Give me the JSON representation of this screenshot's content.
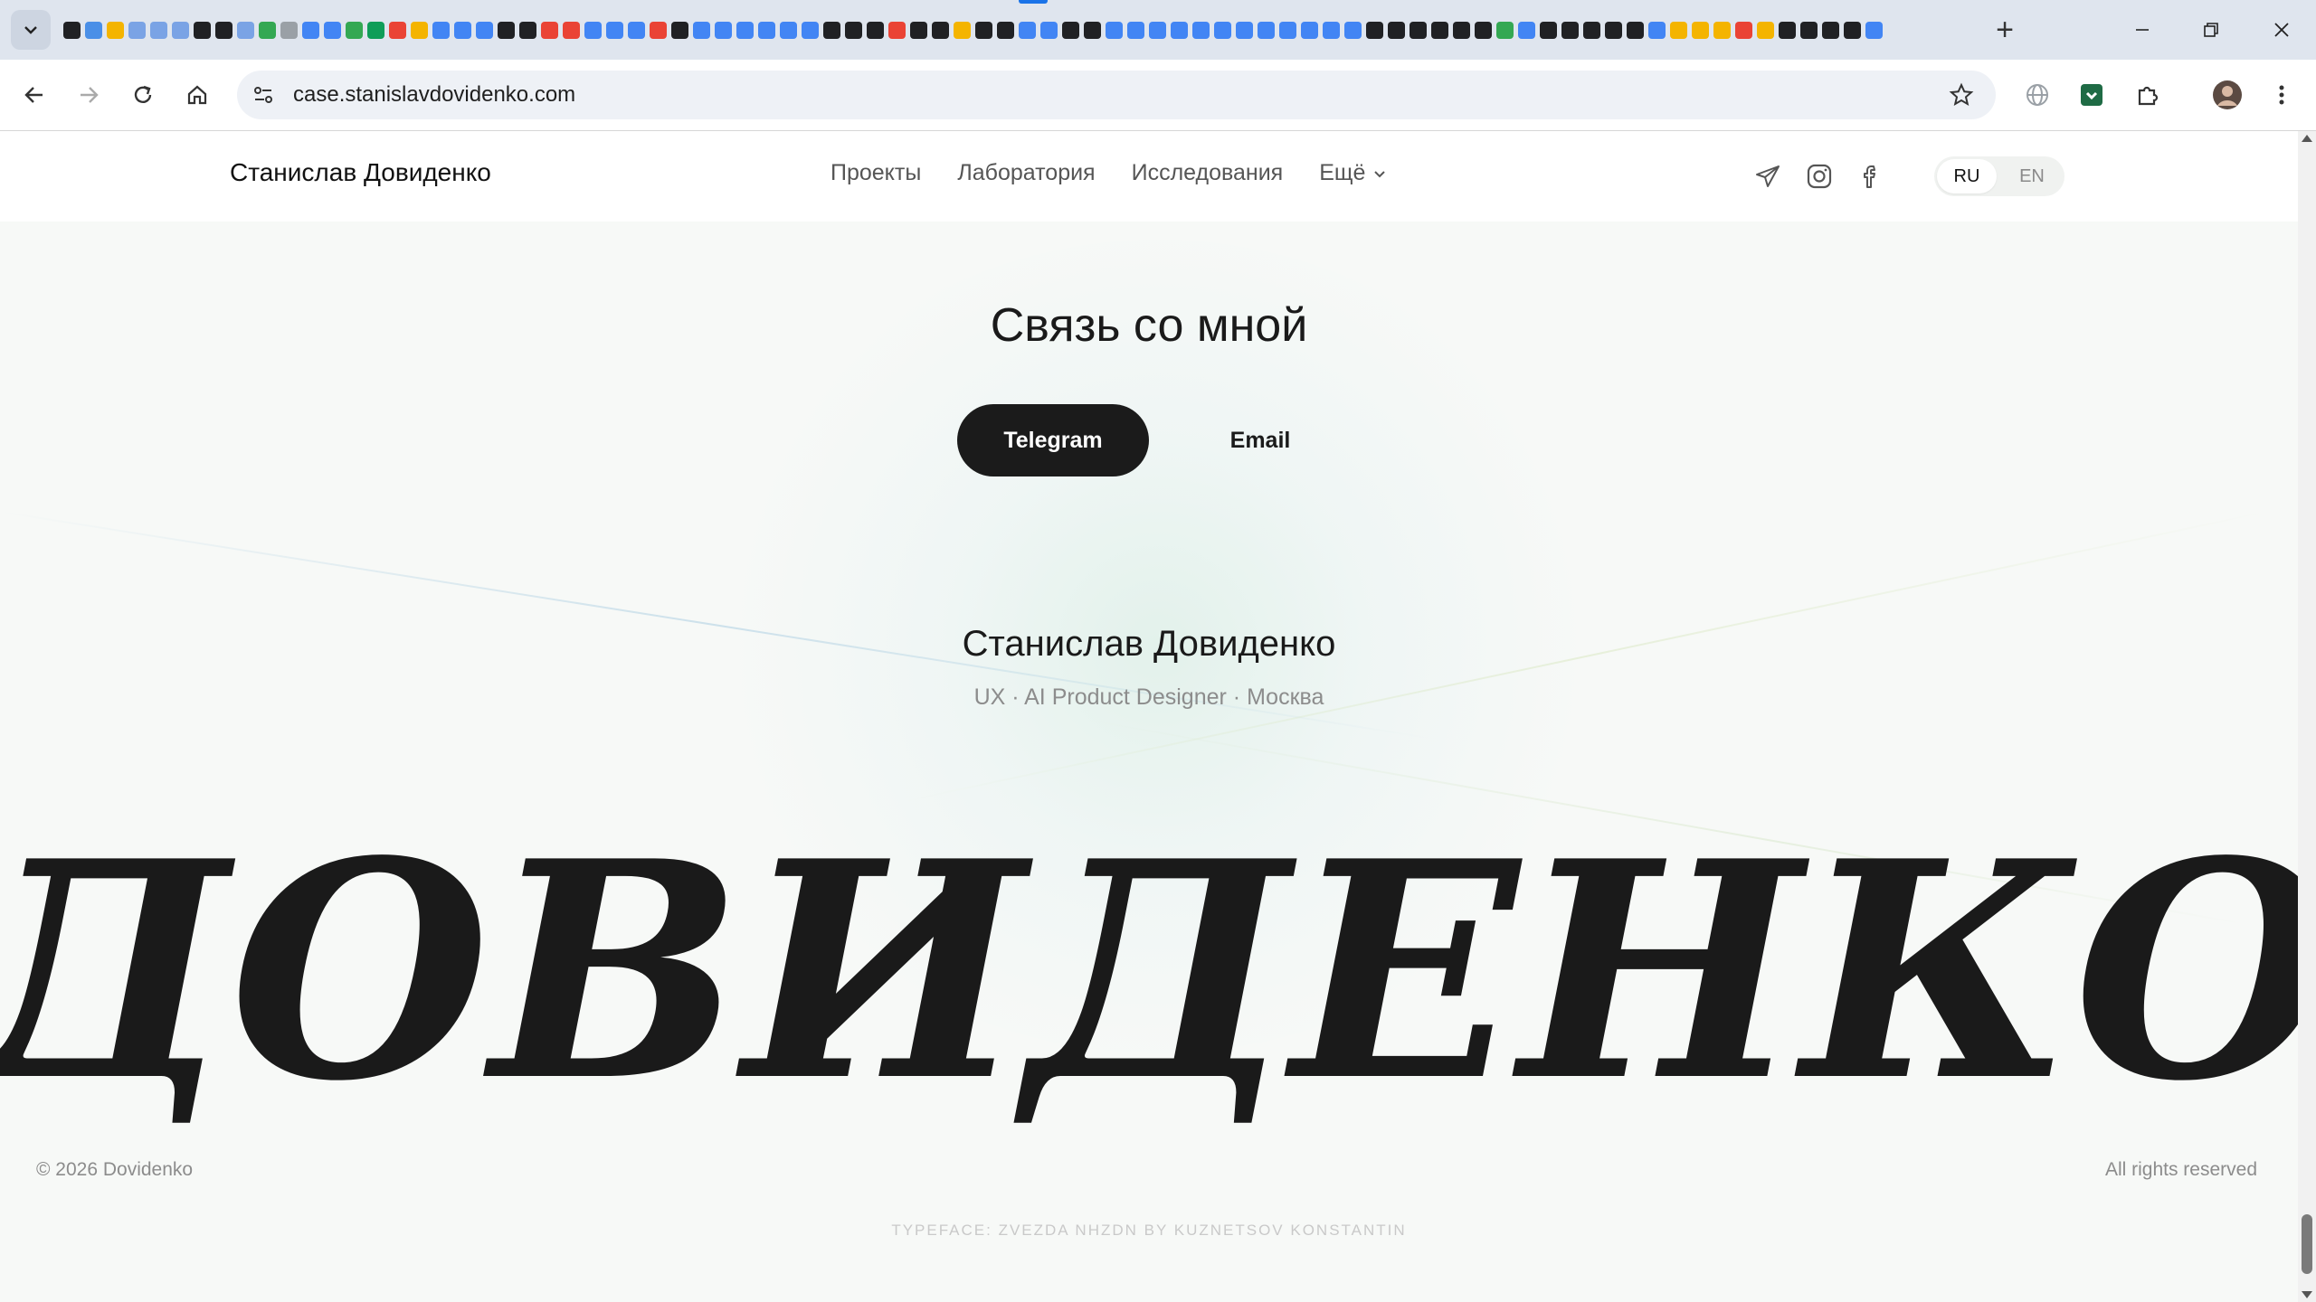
{
  "browser": {
    "url": "case.stanislavdovidenko.com",
    "new_tab_label": "+",
    "favicon_colors": [
      "#202124",
      "#4a8fe7",
      "#f4b400",
      "#7aa3e5",
      "#7aa3e5",
      "#7aa3e5",
      "#202124",
      "#202124",
      "#7aa3e5",
      "#34a853",
      "#9aa0a6",
      "#4285f4",
      "#4285f4",
      "#34a853",
      "#0f9d58",
      "#ea4335",
      "#f4b400",
      "#4285f4",
      "#4285f4",
      "#4285f4",
      "#202124",
      "#202124",
      "#ea4335",
      "#ea4335",
      "#4285f4",
      "#4285f4",
      "#4285f4",
      "#ea4335",
      "#202124",
      "#4285f4",
      "#4285f4",
      "#4285f4",
      "#4285f4",
      "#4285f4",
      "#4285f4",
      "#202124",
      "#202124",
      "#202124",
      "#ea4335",
      "#202124",
      "#202124",
      "#f4b400",
      "#202124",
      "#202124",
      "#4285f4",
      "#4285f4",
      "#202124",
      "#202124",
      "#4285f4",
      "#4285f4",
      "#4285f4",
      "#4285f4",
      "#4285f4",
      "#4285f4",
      "#4285f4",
      "#4285f4",
      "#4285f4",
      "#4285f4",
      "#4285f4",
      "#4285f4",
      "#202124",
      "#202124",
      "#202124",
      "#202124",
      "#202124",
      "#202124",
      "#34a853",
      "#4285f4",
      "#202124",
      "#202124",
      "#202124",
      "#202124",
      "#202124",
      "#4285f4",
      "#f4b400",
      "#f4b400",
      "#f4b400",
      "#ea4335",
      "#f4b400",
      "#202124",
      "#202124",
      "#202124",
      "#202124",
      "#4285f4"
    ]
  },
  "header": {
    "logo": "Станислав Довиденко",
    "nav": [
      "Проекты",
      "Лаборатория",
      "Исследования"
    ],
    "more_label": "Ещё",
    "lang_active": "RU",
    "lang_inactive": "EN"
  },
  "contact": {
    "title": "Связь со мной",
    "telegram_label": "Telegram",
    "email_label": "Email"
  },
  "person": {
    "name": "Станислав Довиденко",
    "role": "UX · AI Product Designer · Москва"
  },
  "big_word": "ДОВИДЕНКО",
  "footer": {
    "copyright": "© 2026 Dovidenko",
    "rights": "All rights reserved",
    "typeface": "TYPEFACE: ZVEZDA NHZDN BY KUZNETSOV KONSTANTIN"
  }
}
